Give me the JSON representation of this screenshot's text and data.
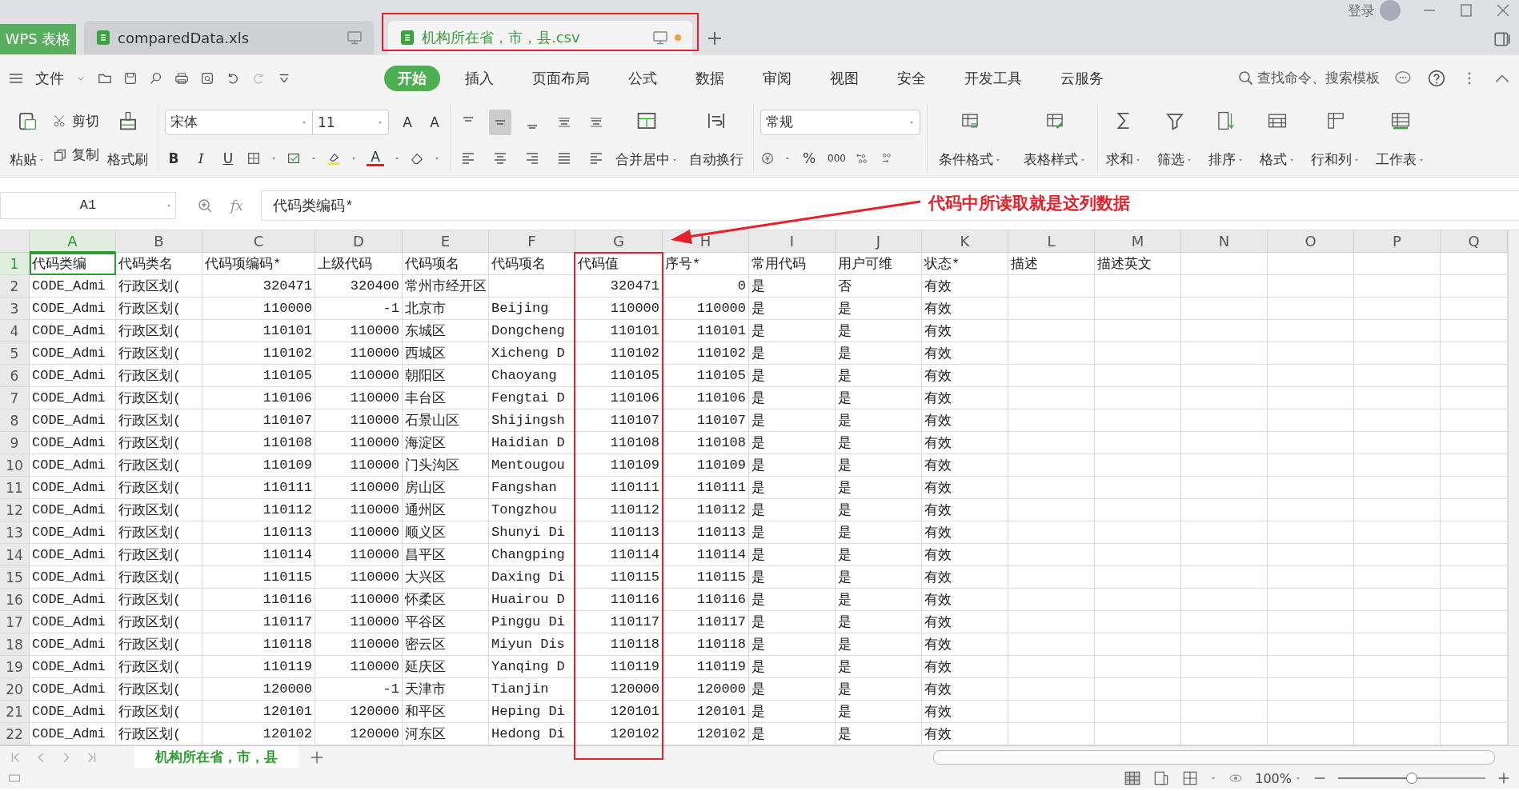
{
  "title_bar": {
    "app_label": "WPS 表格",
    "login": "登录",
    "tabs": [
      {
        "label": "comparedData.xls",
        "selected": false,
        "modified": false,
        "highlighted": false
      },
      {
        "label": "机构所在省，市，县.csv",
        "selected": true,
        "modified": true,
        "highlighted": true
      }
    ]
  },
  "menu_bar": {
    "file": "文件",
    "search": "查找命令、搜索模板",
    "tabs": [
      {
        "label": "开始",
        "selected": true
      },
      {
        "label": "插入",
        "selected": false
      },
      {
        "label": "页面布局",
        "selected": false
      },
      {
        "label": "公式",
        "selected": false
      },
      {
        "label": "数据",
        "selected": false
      },
      {
        "label": "审阅",
        "selected": false
      },
      {
        "label": "视图",
        "selected": false
      },
      {
        "label": "安全",
        "selected": false
      },
      {
        "label": "开发工具",
        "selected": false
      },
      {
        "label": "云服务",
        "selected": false
      }
    ]
  },
  "ribbon": {
    "paste": "粘贴",
    "cut": "剪切",
    "copy": "复制",
    "format_painter": "格式刷",
    "font": "宋体",
    "font_size": "11",
    "font_grow": "A",
    "font_shrink": "A",
    "bold": "B",
    "italic": "I",
    "underline": "U",
    "font_color": "A",
    "merge": "合并居中",
    "wrap": "自动换行",
    "number_format": "常规",
    "percent": "%",
    "thousands": "000",
    "commands": [
      "条件格式",
      "表格样式",
      "求和",
      "筛选",
      "排序",
      "格式",
      "行和列",
      "工作表"
    ]
  },
  "formula_bar": {
    "name_box": "A1",
    "fx": "fx",
    "formula": "代码类编码*"
  },
  "grid": {
    "columns": [
      {
        "label": "A",
        "selected": true,
        "highlighted": false
      },
      {
        "label": "B",
        "selected": false,
        "highlighted": false
      },
      {
        "label": "C",
        "selected": false,
        "highlighted": false
      },
      {
        "label": "D",
        "selected": false,
        "highlighted": false
      },
      {
        "label": "E",
        "selected": false,
        "highlighted": false
      },
      {
        "label": "F",
        "selected": false,
        "highlighted": false
      },
      {
        "label": "G",
        "selected": false,
        "highlighted": true
      },
      {
        "label": "H",
        "selected": false,
        "highlighted": false
      },
      {
        "label": "I",
        "selected": false,
        "highlighted": false
      },
      {
        "label": "J",
        "selected": false,
        "highlighted": false
      },
      {
        "label": "K",
        "selected": false,
        "highlighted": false
      },
      {
        "label": "L",
        "selected": false,
        "highlighted": false
      },
      {
        "label": "M",
        "selected": false,
        "highlighted": false
      },
      {
        "label": "N",
        "selected": false,
        "highlighted": false
      },
      {
        "label": "O",
        "selected": false,
        "highlighted": false
      },
      {
        "label": "P",
        "selected": false,
        "highlighted": false
      },
      {
        "label": "Q",
        "selected": false,
        "highlighted": false
      }
    ],
    "rows": [
      {
        "number": "1",
        "selected": true,
        "cells": [
          "代码类编",
          "代码类名",
          "代码项编码*",
          "上级代码",
          "代码项名",
          "代码项名",
          "代码值",
          "序号*",
          "常用代码",
          "用户可维",
          "状态*",
          "描述",
          "描述英文"
        ]
      },
      {
        "number": "2",
        "selected": false,
        "cells": [
          "CODE_Admi",
          "行政区划(",
          "320471",
          "320400",
          "常州市经开区",
          "",
          "320471",
          "0",
          "是",
          "否",
          "有效"
        ]
      },
      {
        "number": "3",
        "selected": false,
        "cells": [
          "CODE_Admi",
          "行政区划(",
          "110000",
          "-1",
          "北京市",
          "Beijing",
          "110000",
          "110000",
          "是",
          "是",
          "有效"
        ]
      },
      {
        "number": "4",
        "selected": false,
        "cells": [
          "CODE_Admi",
          "行政区划(",
          "110101",
          "110000",
          "东城区",
          "Dongcheng",
          "110101",
          "110101",
          "是",
          "是",
          "有效"
        ]
      },
      {
        "number": "5",
        "selected": false,
        "cells": [
          "CODE_Admi",
          "行政区划(",
          "110102",
          "110000",
          "西城区",
          "Xicheng D",
          "110102",
          "110102",
          "是",
          "是",
          "有效"
        ]
      },
      {
        "number": "6",
        "selected": false,
        "cells": [
          "CODE_Admi",
          "行政区划(",
          "110105",
          "110000",
          "朝阳区",
          "Chaoyang",
          "110105",
          "110105",
          "是",
          "是",
          "有效"
        ]
      },
      {
        "number": "7",
        "selected": false,
        "cells": [
          "CODE_Admi",
          "行政区划(",
          "110106",
          "110000",
          "丰台区",
          "Fengtai D",
          "110106",
          "110106",
          "是",
          "是",
          "有效"
        ]
      },
      {
        "number": "8",
        "selected": false,
        "cells": [
          "CODE_Admi",
          "行政区划(",
          "110107",
          "110000",
          "石景山区",
          "Shijingsh",
          "110107",
          "110107",
          "是",
          "是",
          "有效"
        ]
      },
      {
        "number": "9",
        "selected": false,
        "cells": [
          "CODE_Admi",
          "行政区划(",
          "110108",
          "110000",
          "海淀区",
          "Haidian D",
          "110108",
          "110108",
          "是",
          "是",
          "有效"
        ]
      },
      {
        "number": "10",
        "selected": false,
        "cells": [
          "CODE_Admi",
          "行政区划(",
          "110109",
          "110000",
          "门头沟区",
          "Mentougou",
          "110109",
          "110109",
          "是",
          "是",
          "有效"
        ]
      },
      {
        "number": "11",
        "selected": false,
        "cells": [
          "CODE_Admi",
          "行政区划(",
          "110111",
          "110000",
          "房山区",
          "Fangshan",
          "110111",
          "110111",
          "是",
          "是",
          "有效"
        ]
      },
      {
        "number": "12",
        "selected": false,
        "cells": [
          "CODE_Admi",
          "行政区划(",
          "110112",
          "110000",
          "通州区",
          "Tongzhou",
          "110112",
          "110112",
          "是",
          "是",
          "有效"
        ]
      },
      {
        "number": "13",
        "selected": false,
        "cells": [
          "CODE_Admi",
          "行政区划(",
          "110113",
          "110000",
          "顺义区",
          "Shunyi Di",
          "110113",
          "110113",
          "是",
          "是",
          "有效"
        ]
      },
      {
        "number": "14",
        "selected": false,
        "cells": [
          "CODE_Admi",
          "行政区划(",
          "110114",
          "110000",
          "昌平区",
          "Changping",
          "110114",
          "110114",
          "是",
          "是",
          "有效"
        ]
      },
      {
        "number": "15",
        "selected": false,
        "cells": [
          "CODE_Admi",
          "行政区划(",
          "110115",
          "110000",
          "大兴区",
          "Daxing Di",
          "110115",
          "110115",
          "是",
          "是",
          "有效"
        ]
      },
      {
        "number": "16",
        "selected": false,
        "cells": [
          "CODE_Admi",
          "行政区划(",
          "110116",
          "110000",
          "怀柔区",
          "Huairou D",
          "110116",
          "110116",
          "是",
          "是",
          "有效"
        ]
      },
      {
        "number": "17",
        "selected": false,
        "cells": [
          "CODE_Admi",
          "行政区划(",
          "110117",
          "110000",
          "平谷区",
          "Pinggu Di",
          "110117",
          "110117",
          "是",
          "是",
          "有效"
        ]
      },
      {
        "number": "18",
        "selected": false,
        "cells": [
          "CODE_Admi",
          "行政区划(",
          "110118",
          "110000",
          "密云区",
          "Miyun Dis",
          "110118",
          "110118",
          "是",
          "是",
          "有效"
        ]
      },
      {
        "number": "19",
        "selected": false,
        "cells": [
          "CODE_Admi",
          "行政区划(",
          "110119",
          "110000",
          "延庆区",
          "Yanqing D",
          "110119",
          "110119",
          "是",
          "是",
          "有效"
        ]
      },
      {
        "number": "20",
        "selected": false,
        "cells": [
          "CODE_Admi",
          "行政区划(",
          "120000",
          "-1",
          "天津市",
          "Tianjin",
          "120000",
          "120000",
          "是",
          "是",
          "有效"
        ]
      },
      {
        "number": "21",
        "selected": false,
        "cells": [
          "CODE_Admi",
          "行政区划(",
          "120101",
          "120000",
          "和平区",
          "Heping Di",
          "120101",
          "120101",
          "是",
          "是",
          "有效"
        ]
      },
      {
        "number": "22",
        "selected": false,
        "cells": [
          "CODE_Admi",
          "行政区划(",
          "120102",
          "120000",
          "河东区",
          "Hedong Di",
          "120102",
          "120102",
          "是",
          "是",
          "有效"
        ]
      }
    ]
  },
  "sheet_tabs": [
    {
      "label": "机构所在省，市，县",
      "selected": true
    }
  ],
  "status_bar": {
    "zoom": "100%",
    "zoom_slider": {
      "level": 0.5
    }
  },
  "annotation": {
    "text": "代码中所读取就是这列数据"
  }
}
